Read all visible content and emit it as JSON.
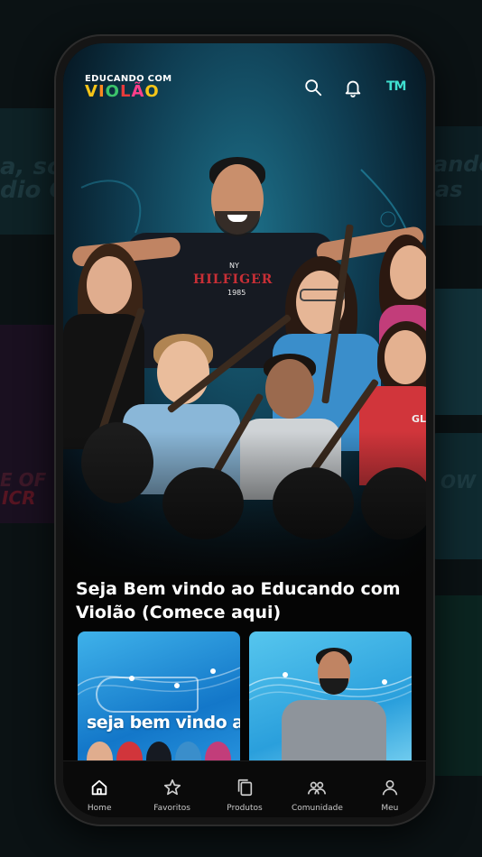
{
  "header": {
    "logo_top": "EDUCANDO COM",
    "logo_bottom_letters": [
      "V",
      "I",
      "O",
      "L",
      "Ã",
      "O"
    ],
    "brand_mark": "TM",
    "icons": [
      "search-icon",
      "bell-icon"
    ]
  },
  "hero": {
    "shirt_line1": "NY",
    "shirt_line2": "HILFIGER",
    "shirt_line3": "1985",
    "girl_shirt": "GLA"
  },
  "section": {
    "title": "Seja Bem vindo ao Educando com Violão (Comece aqui)"
  },
  "cards": [
    {
      "caption": "seja bem vindo ao"
    },
    {
      "caption": ""
    }
  ],
  "bottom_nav": {
    "items": [
      {
        "label": "Home",
        "icon": "home-icon",
        "active": true
      },
      {
        "label": "Favoritos",
        "icon": "star-icon",
        "active": false
      },
      {
        "label": "Produtos",
        "icon": "copy-icon",
        "active": false
      },
      {
        "label": "Comunidade",
        "icon": "community-icon",
        "active": false
      },
      {
        "label": "Meu",
        "icon": "user-icon",
        "active": false
      }
    ]
  },
  "background": {
    "text_1": "a, sou",
    "text_2": "dio Co",
    "text_3": "ando",
    "text_4": "as",
    "text_5": "E OF",
    "text_6": "ICR",
    "text_7": "OW"
  },
  "colors": {
    "accent": "#3fe0d0",
    "background": "#0b1214",
    "screen": "#050505"
  }
}
